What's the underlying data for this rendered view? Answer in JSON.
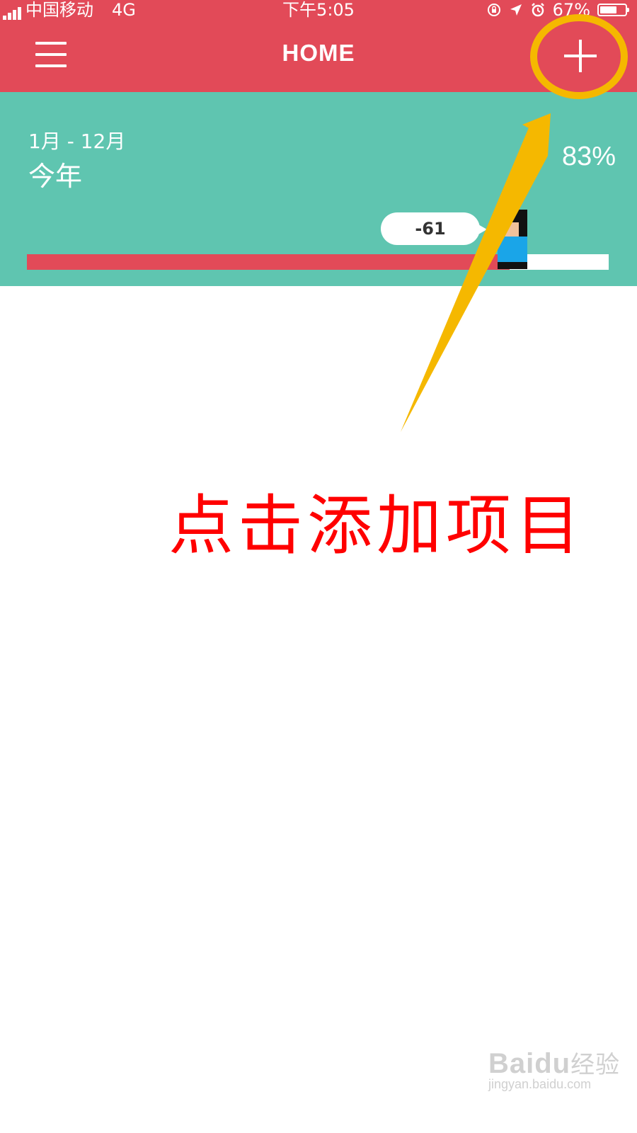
{
  "status_bar": {
    "carrier": "中国移动",
    "network": "4G",
    "time": "下午5:05",
    "battery_percent": "67%",
    "battery_level": 0.67
  },
  "header": {
    "title": "HOME",
    "menu_icon": "hamburger-icon",
    "add_icon": "plus-icon",
    "color": "#e24a58"
  },
  "hero": {
    "range": "1月 - 12月",
    "period": "今年",
    "percent": "83%",
    "bubble_value": "-61",
    "progress": 0.83,
    "background": "#5fc5b0"
  },
  "annotation": {
    "text": "点击添加项目",
    "color": "#ff0000",
    "highlight_color": "#f5b800"
  },
  "watermark": {
    "brand": "Baidu",
    "brand_cn": "经验",
    "url": "jingyan.baidu.com"
  }
}
